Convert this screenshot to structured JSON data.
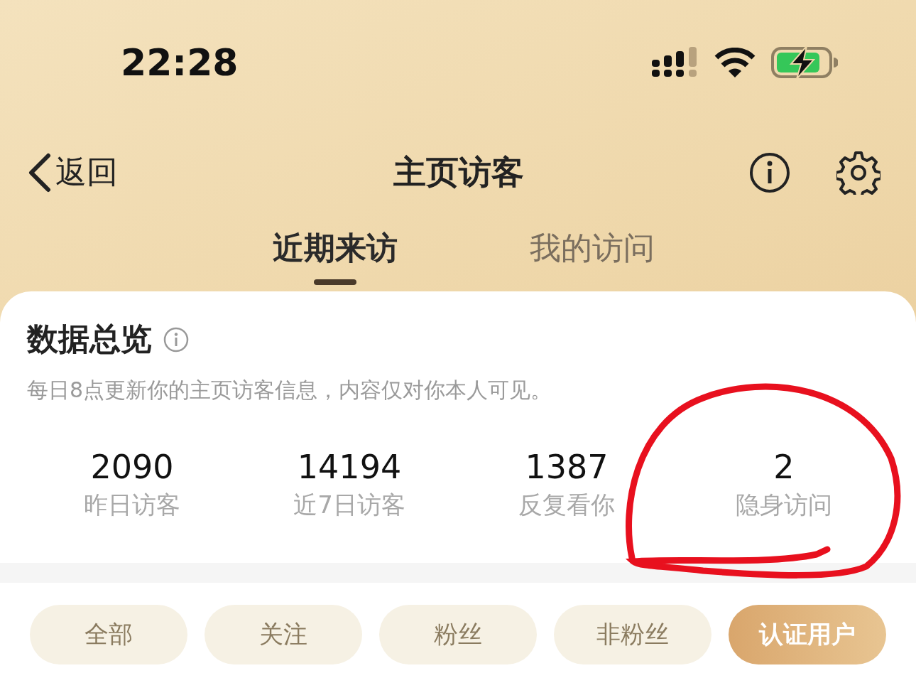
{
  "status_bar": {
    "time": "22:28"
  },
  "nav": {
    "back_label": "返回",
    "title": "主页访客"
  },
  "tabs": [
    {
      "label": "近期来访",
      "selected": true
    },
    {
      "label": "我的访问",
      "selected": false
    }
  ],
  "overview": {
    "title": "数据总览",
    "subtitle": "每日8点更新你的主页访客信息，内容仅对你本人可见。",
    "stats": [
      {
        "value": "2090",
        "label": "昨日访客"
      },
      {
        "value": "14194",
        "label": "近7日访客"
      },
      {
        "value": "1387",
        "label": "反复看你"
      },
      {
        "value": "2",
        "label": "隐身访问"
      }
    ]
  },
  "filters": [
    {
      "label": "全部",
      "selected": false
    },
    {
      "label": "关注",
      "selected": false
    },
    {
      "label": "粉丝",
      "selected": false
    },
    {
      "label": "非粉丝",
      "selected": false
    },
    {
      "label": "认证用户",
      "selected": true
    }
  ]
}
